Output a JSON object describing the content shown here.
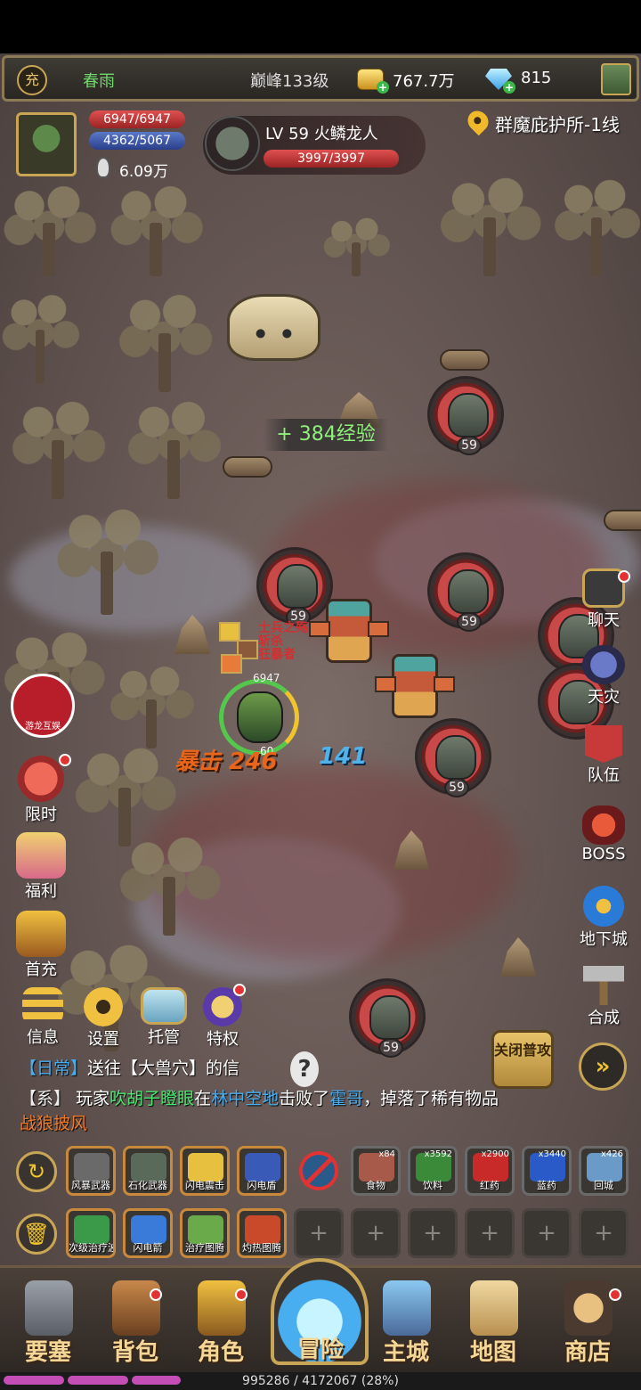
{
  "status_bar": {},
  "top_bar": {
    "charge_label": "充",
    "player_name": "春雨",
    "peak_level": "巅峰133级",
    "gold": "767.7万",
    "diamonds": "815"
  },
  "player": {
    "hp": "6947/6947",
    "mp": "4362/5067",
    "power": "6.09万"
  },
  "target": {
    "name": "LV 59 火鳞龙人",
    "hp": "3997/3997"
  },
  "location": "群魔庇护所-1线",
  "battle": {
    "exp_gain": "+ 384经验",
    "crit_label": "暴击 246",
    "damage": "141",
    "hero_level": "60",
    "hero_hp": "6947",
    "red_float_lines": [
      "士兵之殇",
      "斩杀",
      "狂暴者"
    ],
    "enemy_level": "59"
  },
  "left_menu": {
    "youlong_label": "游龙互娱",
    "items": [
      {
        "label": "限时",
        "icon": "sale-icon"
      },
      {
        "label": "福利",
        "icon": "gift-icon"
      },
      {
        "label": "首充",
        "icon": "chest-icon"
      }
    ],
    "bottom_row": [
      {
        "label": "信息",
        "icon": "menu-icon"
      },
      {
        "label": "设置",
        "icon": "gear-icon"
      },
      {
        "label": "托管",
        "icon": "autoplay-icon"
      },
      {
        "label": "特权",
        "icon": "privilege-icon"
      }
    ]
  },
  "right_menu": {
    "items": [
      {
        "label": "聊天",
        "icon": "chat-icon"
      },
      {
        "label": "天灾",
        "icon": "demon-icon"
      },
      {
        "label": "队伍",
        "icon": "team-flag-icon"
      },
      {
        "label": "BOSS",
        "icon": "boss-icon"
      },
      {
        "label": "地下城",
        "icon": "dungeon-icon"
      },
      {
        "label": "合成",
        "icon": "hammer-icon"
      }
    ],
    "close_attack": "关闭普攻",
    "speed_icon": "»"
  },
  "chat": {
    "line1_tag": "【日常】",
    "line1_text": "送往【大兽穴】的信",
    "line2_tag": "【系】",
    "line2_pre": "玩家",
    "line2_player": "吹胡子瞪眼",
    "line2_mid": "在",
    "line2_place": "林中空地",
    "line2_mid2": "击败了",
    "line2_boss": "霍哥",
    "line2_post": "，掉落了稀有物品",
    "line3_item": "战狼披风"
  },
  "skills_row1": [
    {
      "label": "风暴武器",
      "art": "#6a6a6a"
    },
    {
      "label": "石化武器",
      "art": "#5a6a5a"
    },
    {
      "label": "闪电震击",
      "art": "#e8c040"
    },
    {
      "label": "闪电盾",
      "art": "#3a5ab8"
    }
  ],
  "items_row1": [
    {
      "label": "食物",
      "count": "x84",
      "art": "#a85a4a"
    },
    {
      "label": "饮料",
      "count": "x3592",
      "art": "#3a8a3a"
    },
    {
      "label": "红药",
      "count": "x2900",
      "art": "#c82a2a"
    },
    {
      "label": "蓝药",
      "count": "x3440",
      "art": "#2a5ac8"
    },
    {
      "label": "回城",
      "count": "x426",
      "art": "#6a9ac8"
    }
  ],
  "skills_row2": [
    {
      "label": "次级治疗波",
      "art": "#3a9a4a"
    },
    {
      "label": "闪电箭",
      "art": "#3a7ad8"
    },
    {
      "label": "治疗图腾",
      "art": "#6aaa4a"
    },
    {
      "label": "灼热图腾",
      "art": "#c84a2a"
    }
  ],
  "empty_slot": "+",
  "bottom_nav": [
    {
      "label": "要塞",
      "icon": "fortress-icon"
    },
    {
      "label": "背包",
      "icon": "backpack-icon"
    },
    {
      "label": "角色",
      "icon": "helmet-icon"
    },
    {
      "label": "冒险",
      "icon": "portal-icon"
    },
    {
      "label": "主城",
      "icon": "castle-icon"
    },
    {
      "label": "地图",
      "icon": "map-icon"
    },
    {
      "label": "商店",
      "icon": "shop-icon"
    }
  ],
  "xp": {
    "text": "995286 / 4172067 (28%)",
    "progress": 0.28
  },
  "colors": {
    "gold_accent": "#c8a656",
    "hp_red": "#e05050",
    "mp_blue": "#5a78c8",
    "exp_green": "#8ef07a",
    "xp_pink": "#c34fb6"
  }
}
